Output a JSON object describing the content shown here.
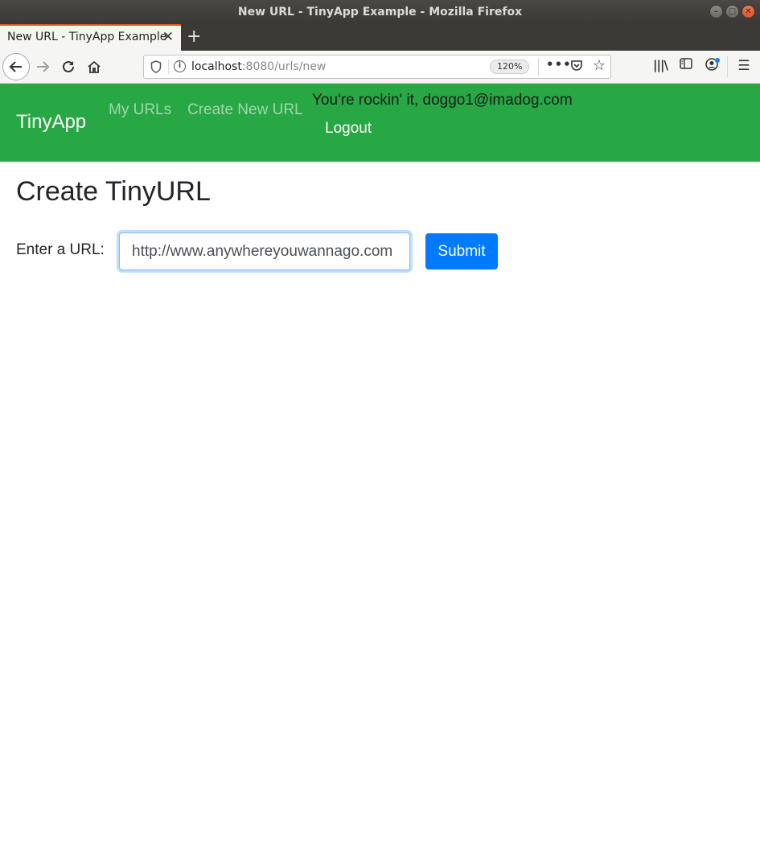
{
  "window": {
    "title": "New URL - TinyApp Example - Mozilla Firefox",
    "minimize_glyph": "–",
    "maximize_glyph": "□",
    "close_glyph": "✕"
  },
  "browser": {
    "tab_title": "New URL - TinyApp Example",
    "tab_close_glyph": "✕",
    "new_tab_glyph": "+",
    "url_host": "localhost",
    "url_rest": ":8080/urls/new",
    "zoom": "120%",
    "accent_color": "#e95420"
  },
  "site": {
    "brand": "TinyApp",
    "nav_my_urls": "My URLs",
    "nav_create": "Create New URL",
    "greeting": "You're rockin' it, doggo1@imadog.com",
    "logout": "Logout",
    "navbar_color": "#28a745"
  },
  "form": {
    "title": "Create TinyURL",
    "label": "Enter a URL:",
    "placeholder": "http://www.anywhereyouwannago.com",
    "submit": "Submit",
    "button_color": "#007bff"
  }
}
